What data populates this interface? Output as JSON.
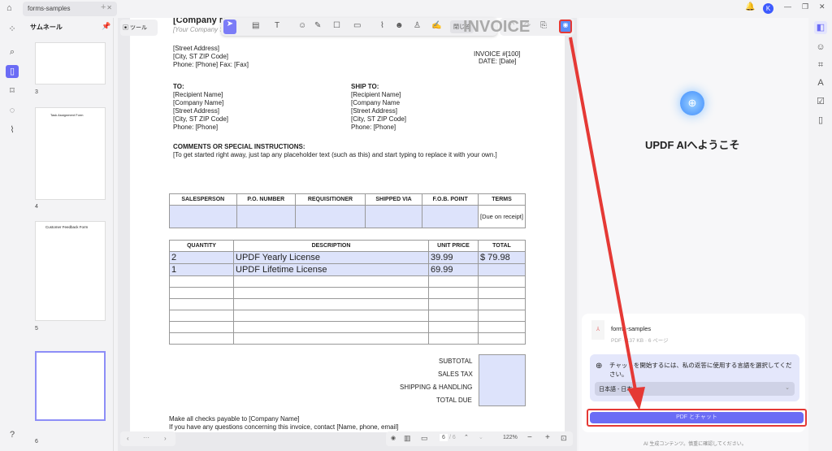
{
  "tab": {
    "title": "forms-samples"
  },
  "thumbs": {
    "title": "サムネール",
    "pages": [
      "3",
      "4",
      "5",
      "6"
    ],
    "tool_label": "ツール",
    "thumb_titles": [
      "Task Assignment Form",
      "Customer Feedback Form"
    ]
  },
  "toolbar": {
    "close_label": "閉じる"
  },
  "invoice": {
    "company": "[Company Name]",
    "slogan": "[Your Company Slogan]",
    "heading": "INVOICE",
    "address": [
      "[Street Address]",
      "[City, ST ZIP Code]",
      "Phone: [Phone]  Fax: [Fax]"
    ],
    "number": "INVOICE #[100]",
    "date": "DATE: [Date]",
    "to_label": "TO:",
    "to": [
      "[Recipient Name]",
      "[Company Name]",
      "[Street Address]",
      "[City, ST ZIP Code]",
      "Phone: [Phone]"
    ],
    "ship_label": "SHIP TO:",
    "ship": [
      "[Recipient Name]",
      "[Company Name",
      "[Street Address]",
      "[City, ST ZIP Code]",
      "Phone: [Phone]"
    ],
    "comments_label": "COMMENTS OR SPECIAL INSTRUCTIONS:",
    "comments": "[To get started right away, just tap any placeholder text (such as this) and start typing to replace it with your own.]",
    "info_headers": [
      "SALESPERSON",
      "P.O. NUMBER",
      "REQUISITIONER",
      "SHIPPED VIA",
      "F.O.B. POINT",
      "TERMS"
    ],
    "terms": "[Due on receipt]",
    "item_headers": [
      "QUANTITY",
      "DESCRIPTION",
      "UNIT PRICE",
      "TOTAL"
    ],
    "items": [
      {
        "qty": "2",
        "desc": "UPDF Yearly License",
        "price": "39.99",
        "total": "$ 79.98"
      },
      {
        "qty": "1",
        "desc": "UPDF Lifetime License",
        "price": "69.99",
        "total": ""
      }
    ],
    "totals": [
      "SUBTOTAL",
      "SALES TAX",
      "SHIPPING & HANDLING",
      "TOTAL DUE"
    ],
    "footer1": "Make all checks payable to [Company Name]",
    "footer2": "If you have any questions concerning this invoice, contact [Name, phone, email]"
  },
  "bottom": {
    "page": "6",
    "page_total": "/ 6",
    "zoom": "122%"
  },
  "ai": {
    "welcome": "UPDF AIへようこそ",
    "file_name": "forms-samples",
    "file_meta": "PDF · 137 KB · 6 ページ",
    "prompt": "チャットを開始するには、私の返答に使用する言語を選択してください。",
    "language": "日本語 - 日本",
    "chat_button": "PDF とチャット",
    "disclaimer": "AI 生成コンテンツ。慎重に確認してください。"
  },
  "colors": {
    "accent": "#6b6cf5",
    "highlight": "#e53935"
  }
}
